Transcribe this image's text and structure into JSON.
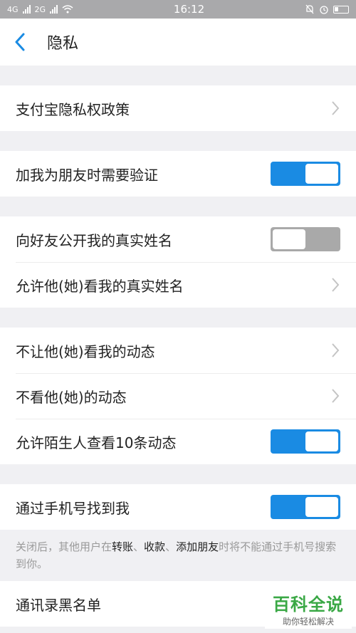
{
  "status": {
    "time": "16:12",
    "sim1": "4G",
    "sim2": "2G"
  },
  "header": {
    "title": "隐私"
  },
  "groups": {
    "g1": {
      "alipay_policy": "支付宝隐私权政策"
    },
    "g2": {
      "verify_friend": "加我为朋友时需要验证",
      "verify_friend_on": true
    },
    "g3": {
      "show_real_name": "向好友公开我的真实姓名",
      "show_real_name_on": false,
      "allow_view_real_name": "允许他(她)看我的真实姓名"
    },
    "g4": {
      "block_feed": "不让他(她)看我的动态",
      "hide_feed": "不看他(她)的动态",
      "stranger_view": "允许陌生人查看10条动态",
      "stranger_view_on": true
    },
    "g5": {
      "find_by_phone": "通过手机号找到我",
      "find_by_phone_on": true
    },
    "note": {
      "p1": "关闭后，其他用户在",
      "h1": "转账",
      "s1": "、",
      "h2": "收款",
      "s2": "、",
      "h3": "添加朋友",
      "p2": "时将不能通过手机号搜索到你。"
    },
    "g6": {
      "contacts_blacklist": "通讯录黑名单"
    }
  },
  "watermark": {
    "main": "百科全说",
    "sub": "助你轻松解决"
  },
  "colors": {
    "accent": "#1a8be3",
    "toggle_off": "#a9a9a9",
    "watermark": "#3aa845"
  }
}
